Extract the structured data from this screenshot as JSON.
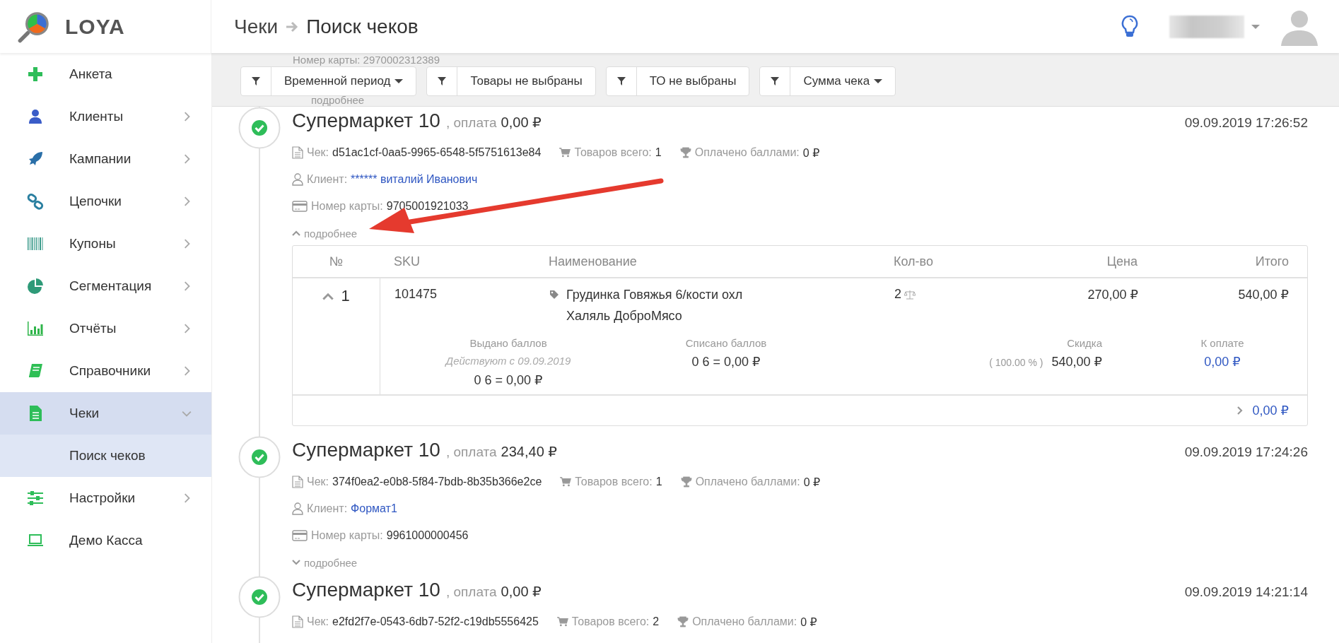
{
  "brand": {
    "name": "LOYA"
  },
  "breadcrumb": [
    {
      "label": "Чеки"
    },
    {
      "label": "Поиск чеков"
    }
  ],
  "filters": [
    {
      "label": "Временной период",
      "dropdown": true
    },
    {
      "label": "Товары не выбраны",
      "dropdown": false
    },
    {
      "label": "ТО не выбраны",
      "dropdown": false
    },
    {
      "label": "Сумма чека",
      "dropdown": true
    }
  ],
  "ghost_row": {
    "card_label": "Номер карты:",
    "card_number": "2970002312389",
    "more": "подробнее"
  },
  "sidebar": {
    "items": [
      {
        "label": "Анкета",
        "has_arrow": false,
        "selected": false
      },
      {
        "label": "Клиенты",
        "has_arrow": true,
        "expanded": false,
        "selected": false
      },
      {
        "label": "Кампании",
        "has_arrow": true,
        "expanded": false,
        "selected": false
      },
      {
        "label": "Цепочки",
        "has_arrow": true,
        "expanded": false,
        "selected": false
      },
      {
        "label": "Купоны",
        "has_arrow": true,
        "expanded": false,
        "selected": false
      },
      {
        "label": "Сегментация",
        "has_arrow": true,
        "expanded": false,
        "selected": false
      },
      {
        "label": "Отчёты",
        "has_arrow": true,
        "expanded": false,
        "selected": false
      },
      {
        "label": "Справочники",
        "has_arrow": true,
        "expanded": false,
        "selected": false
      },
      {
        "label": "Чеки",
        "has_arrow": true,
        "expanded": true,
        "selected": true,
        "children": [
          {
            "label": "Поиск чеков",
            "selected": true
          }
        ]
      },
      {
        "label": "Настройки",
        "has_arrow": true,
        "expanded": false,
        "selected": false
      },
      {
        "label": "Демо Касса",
        "has_arrow": false,
        "selected": false
      }
    ]
  },
  "receipts": [
    {
      "store": "Супермаркет 10",
      "pay_label": ", оплата",
      "amount": "0,00 ₽",
      "date": "09.09.2019 17:26:52",
      "check_label": "Чек:",
      "check_id": "d51ac1cf-0aa5-9965-6548-5f5751613e84",
      "items_label": "Товаров всего:",
      "items_count": "1",
      "points_label": "Оплачено баллами:",
      "points_paid": "0 ₽",
      "client_label": "Клиент:",
      "client": "****** виталий Иванович",
      "card_label": "Номер карты:",
      "card_number": "9705001921033",
      "more": "подробнее",
      "expanded": true,
      "details": {
        "columns": [
          "№",
          "SKU",
          "Наименование",
          "Кол-во",
          "Цена",
          "Итого"
        ],
        "rows": [
          {
            "no": "1",
            "sku": "101475",
            "name": "Грудинка Говяжья 6/кости охл Халяль ДоброМясо",
            "qty": "2",
            "price": "270,00 ₽",
            "total": "540,00 ₽",
            "expanded": true,
            "issued_label": "Выдано баллов",
            "issued_note": "Действуют с 09.09.2019",
            "issued_value": "0 6 = 0,00 ₽",
            "written_label": "Списано баллов",
            "written_value": "0 6 = 0,00 ₽",
            "discount_label": "Скидка",
            "discount_percent": "( 100.00 % )",
            "discount_value": "540,00 ₽",
            "pay_label": "К оплате",
            "pay_value": "0,00 ₽"
          }
        ],
        "footer_total": "0,00 ₽"
      }
    },
    {
      "store": "Супермаркет 10",
      "pay_label": ", оплата",
      "amount": "234,40 ₽",
      "date": "09.09.2019 17:24:26",
      "check_label": "Чек:",
      "check_id": "374f0ea2-e0b8-5f84-7bdb-8b35b366e2ce",
      "items_label": "Товаров всего:",
      "items_count": "1",
      "points_label": "Оплачено баллами:",
      "points_paid": "0 ₽",
      "client_label": "Клиент:",
      "client": "Формат1",
      "card_label": "Номер карты:",
      "card_number": "9961000000456",
      "more": "подробнее",
      "expanded": false
    },
    {
      "store": "Супермаркет 10",
      "pay_label": ", оплата",
      "amount": "0,00 ₽",
      "date": "09.09.2019 14:21:14",
      "check_label": "Чек:",
      "check_id": "e2fd2f7e-0543-6db7-52f2-c19db5556425",
      "items_label": "Товаров всего:",
      "items_count": "2",
      "points_label": "Оплачено баллами:",
      "points_paid": "0 ₽"
    }
  ]
}
